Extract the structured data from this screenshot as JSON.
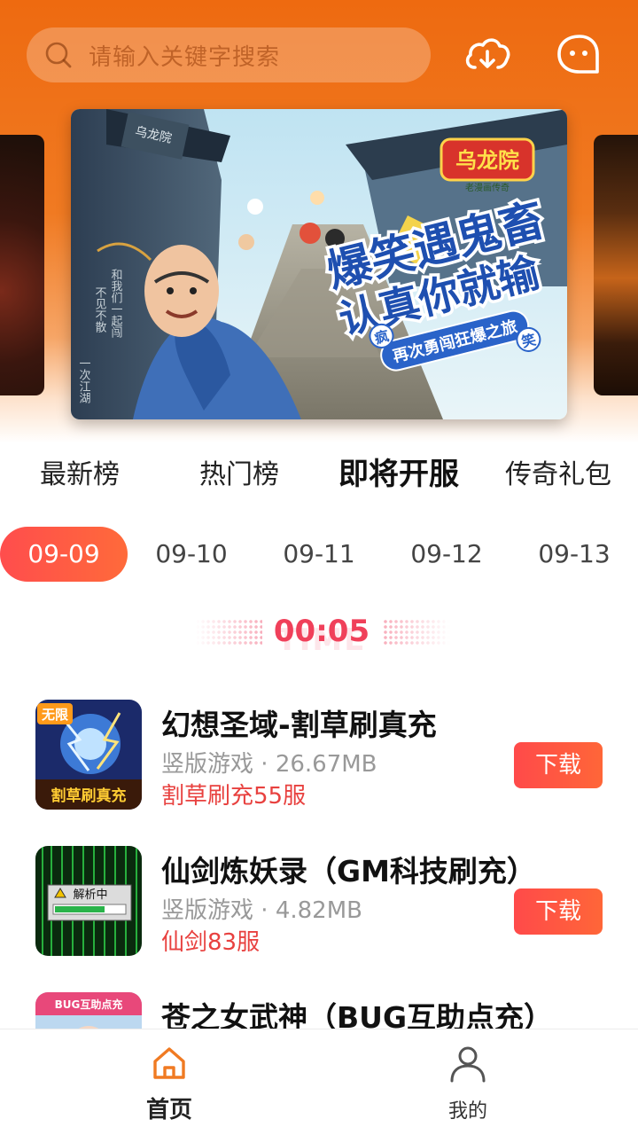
{
  "search": {
    "placeholder": "请输入关键字搜索"
  },
  "header": {
    "download_icon": "cloud-download-icon",
    "message_icon": "message-bubble-icon"
  },
  "banner": {
    "logo_text": "乌龙院",
    "logo_sub": "老漫画传奇",
    "headline_1": "爆笑遇鬼畜",
    "headline_2": "认真你就输",
    "tagline": "再次勇闯狂爆之旅",
    "badge_1": "疯",
    "badge_2": "笑",
    "sign_text": "乌龙院",
    "wall_text_1": "和我们一起闯",
    "wall_text_2": "不见不散",
    "wall_text_3": "一次江湖"
  },
  "rank_tabs": [
    {
      "label": "最新榜"
    },
    {
      "label": "热门榜"
    },
    {
      "label": "即将开服",
      "active": true
    },
    {
      "label": "传奇礼包"
    }
  ],
  "dates": [
    "09-09",
    "09-10",
    "09-11",
    "09-12",
    "09-13"
  ],
  "active_date": "09-09",
  "timer": {
    "value": "00:05",
    "ghost": "TIME"
  },
  "games": [
    {
      "name": "幻想圣域-割草刷真充",
      "type": "竖版游戏",
      "size": "26.67MB",
      "server": "割草刷充55服",
      "button": "下载",
      "icon_text_top": "无限",
      "icon_text_bottom": "割草刷真充"
    },
    {
      "name": "仙剑炼妖录（GM科技刷充）",
      "type": "竖版游戏",
      "size": "4.82MB",
      "server": "仙剑83服",
      "button": "下载",
      "icon_text": "解析中"
    },
    {
      "name": "苍之女武神（BUG互助点充）",
      "icon_text": "BUG互助点充"
    }
  ],
  "meta_separator": "·",
  "bottom_nav": [
    {
      "label": "首页",
      "icon": "home-icon",
      "active": true
    },
    {
      "label": "我的",
      "icon": "user-icon"
    }
  ],
  "colors": {
    "brand": "#ee6a10",
    "accent": "#ff4d4d",
    "server_text": "#e8413f"
  }
}
